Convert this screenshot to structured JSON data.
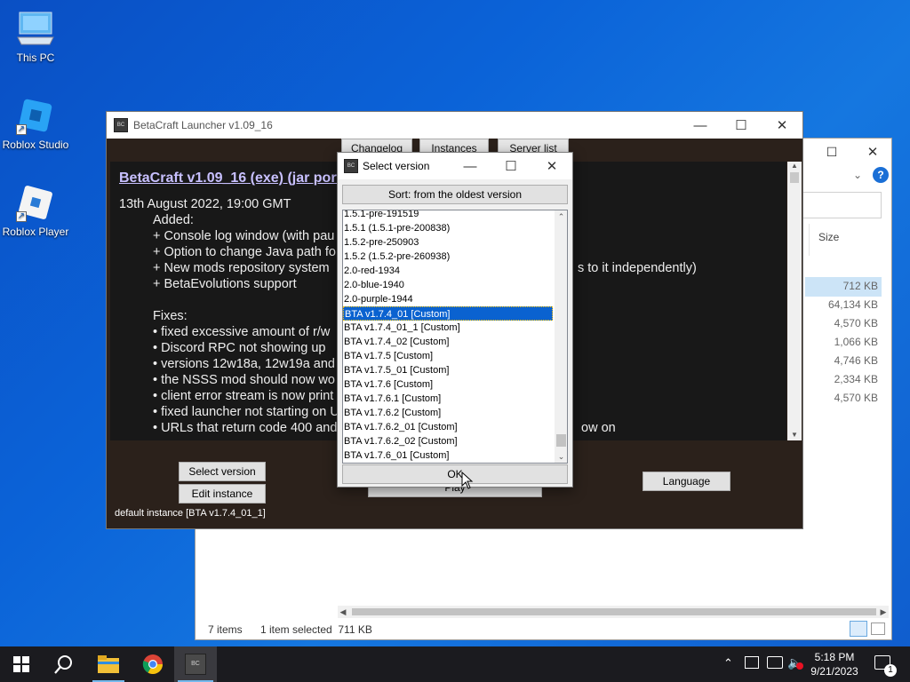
{
  "desktop": {
    "icons": [
      {
        "label": "This PC"
      },
      {
        "label": "Roblox Studio"
      },
      {
        "label": "Roblox Player"
      }
    ]
  },
  "explorer": {
    "column_size": "Size",
    "sizes": [
      "712 KB",
      "64,134 KB",
      "4,570 KB",
      "1,066 KB",
      "4,746 KB",
      "2,334 KB",
      "4,570 KB"
    ],
    "status_items": "7 items",
    "status_selected": "1 item selected  711 KB"
  },
  "betacraft": {
    "title": "BetaCraft Launcher v1.09_16",
    "tabs": [
      "Changelog",
      "Instances",
      "Server list"
    ],
    "changelog": {
      "heading": "BetaCraft v1.09_16 (exe) (jar port",
      "date": "13th August 2022, 19:00 GMT",
      "added_label": "Added:",
      "added": [
        "+ Console log window (with pau",
        "+ Option to change Java path fo",
        "+ New mods repository system",
        "+ BetaEvolutions support"
      ],
      "added_tail": "s to it independently)",
      "fixes_label": "Fixes:",
      "fixes": [
        "• fixed excessive amount of r/w",
        "• Discord RPC not showing up",
        "• versions 12w18a, 12w19a and",
        "• the NSSS mod should now wo",
        "• client error stream is now print",
        "• fixed launcher not starting on U",
        "• URLs that return code 400 and"
      ],
      "fixes_tail": "ow on"
    },
    "buttons": {
      "select_version": "Select version",
      "edit_instance": "Edit instance",
      "play": "Play",
      "language": "Language"
    },
    "instance_label": "default instance [BTA v1.7.4_01_1]"
  },
  "dialog": {
    "title": "Select version",
    "sort_label": "Sort: from the oldest version",
    "versions": [
      "1.5.1-pre-191519",
      "1.5.1 (1.5.1-pre-200838)",
      "1.5.2-pre-250903",
      "1.5.2 (1.5.2-pre-260938)",
      "2.0-red-1934",
      "2.0-blue-1940",
      "2.0-purple-1944",
      "BTA v1.7.4_01 [Custom]",
      "BTA v1.7.4_01_1 [Custom]",
      "BTA v1.7.4_02 [Custom]",
      "BTA v1.7.5 [Custom]",
      "BTA v1.7.5_01 [Custom]",
      "BTA v1.7.6 [Custom]",
      "BTA v1.7.6.1 [Custom]",
      "BTA v1.7.6.2 [Custom]",
      "BTA v1.7.6.2_01 [Custom]",
      "BTA v1.7.6.2_02 [Custom]",
      "BTA v1.7.6_01 [Custom]"
    ],
    "selected_version": "BTA v1.7.4_01 [Custom]",
    "ok_label": "OK"
  },
  "taskbar": {
    "time": "5:18 PM",
    "date": "9/21/2023",
    "notification_count": "1"
  },
  "colors": {
    "selection": "#0a62d0",
    "link": "#c8c0ff",
    "launcher_bg": "#2b211b"
  }
}
